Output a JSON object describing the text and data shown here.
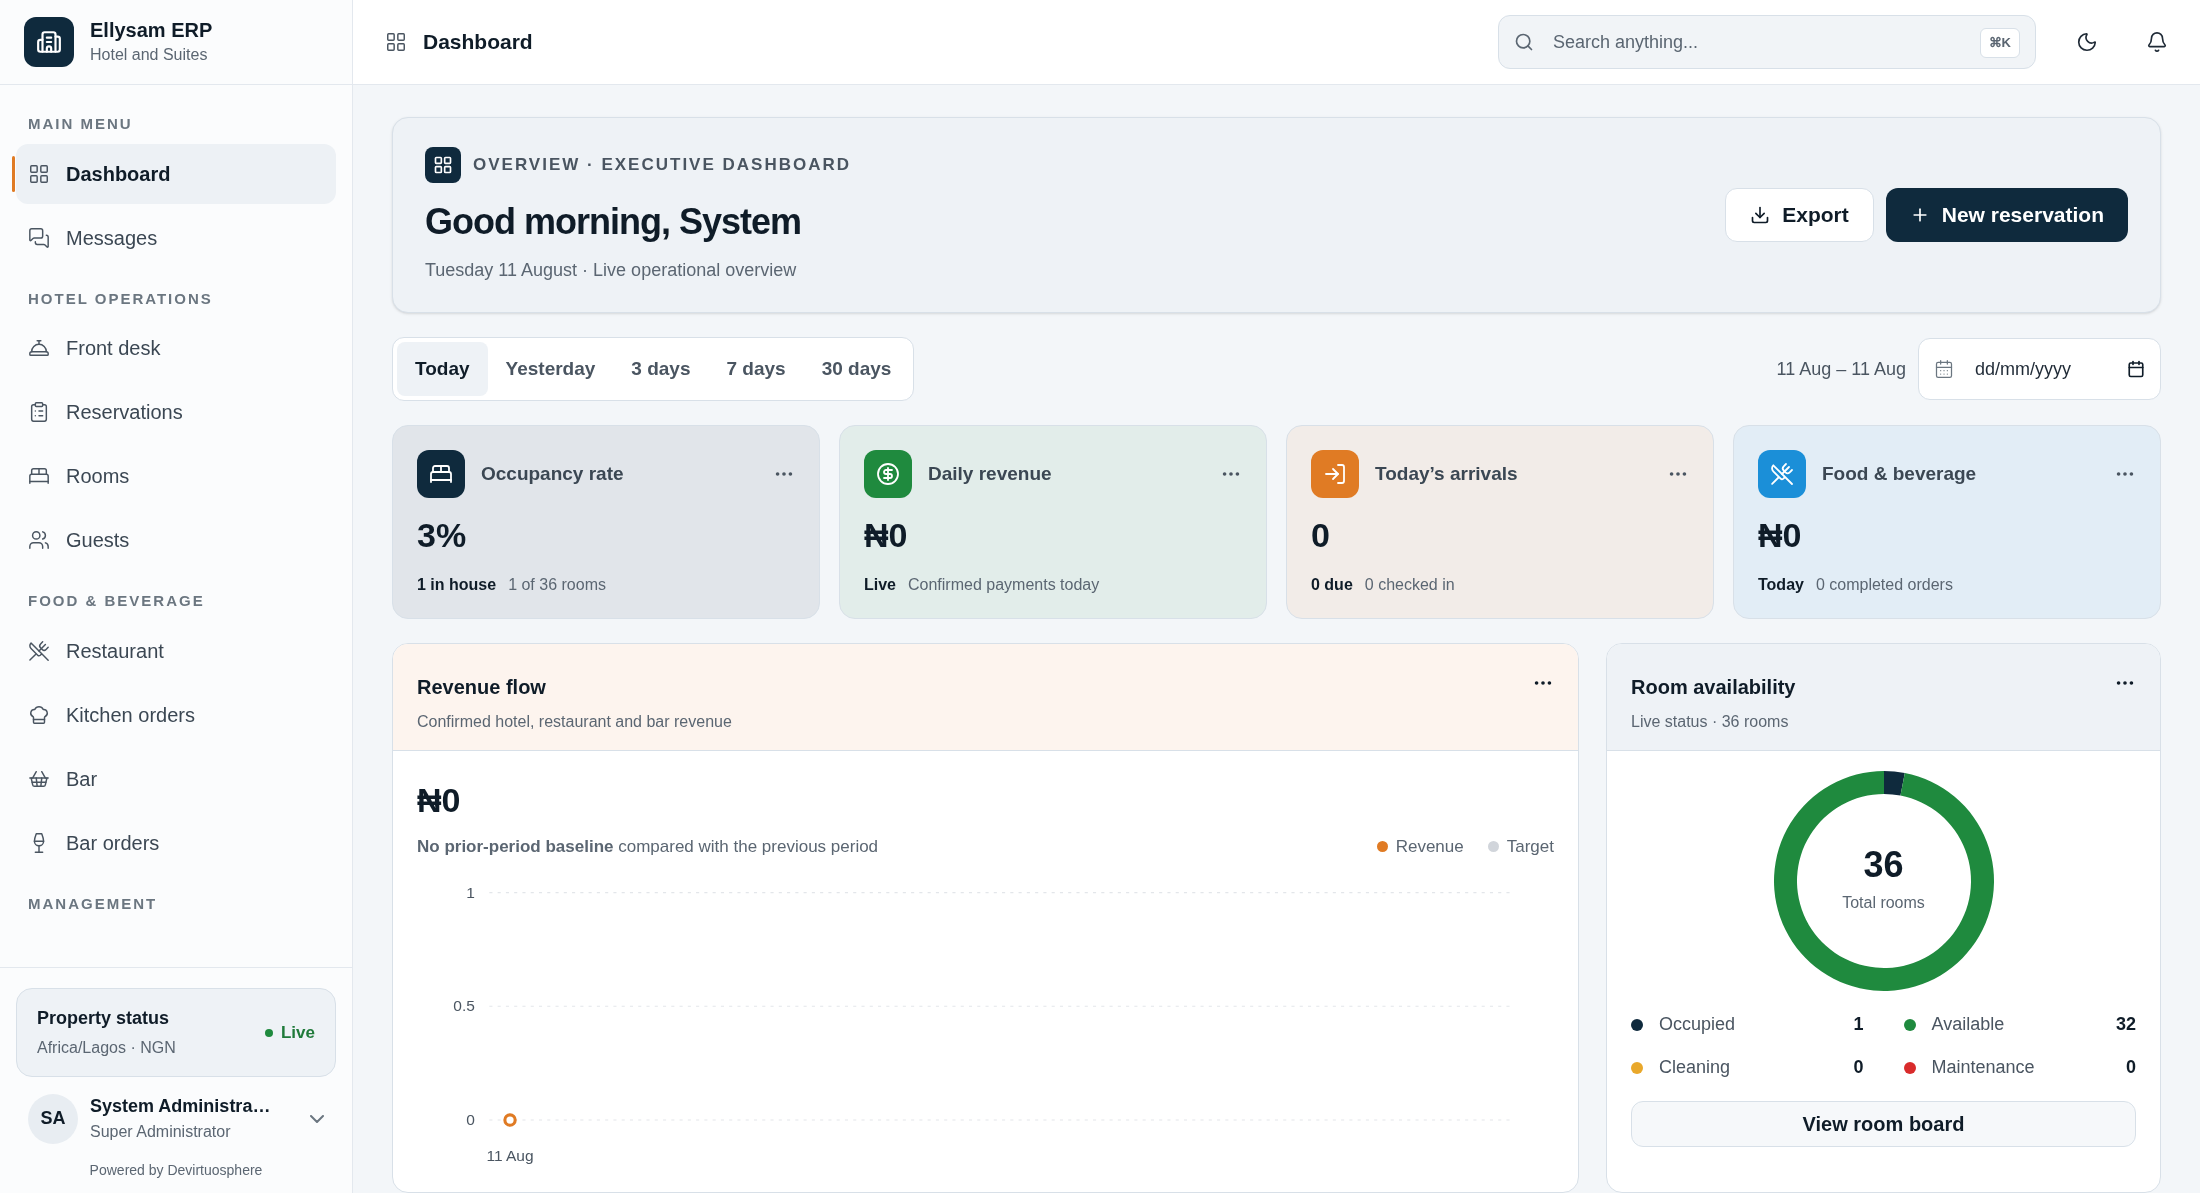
{
  "brand": {
    "name": "Ellysam ERP",
    "subtitle": "Hotel and Suites"
  },
  "sidebar": {
    "sections": [
      {
        "title": "MAIN MENU",
        "items": [
          {
            "label": "Dashboard",
            "selected": true
          },
          {
            "label": "Messages",
            "selected": false
          }
        ]
      },
      {
        "title": "HOTEL OPERATIONS",
        "items": [
          {
            "label": "Front desk",
            "selected": false
          },
          {
            "label": "Reservations",
            "selected": false
          },
          {
            "label": "Rooms",
            "selected": false
          },
          {
            "label": "Guests",
            "selected": false
          }
        ]
      },
      {
        "title": "FOOD & BEVERAGE",
        "items": [
          {
            "label": "Restaurant",
            "selected": false
          },
          {
            "label": "Kitchen orders",
            "selected": false
          },
          {
            "label": "Bar",
            "selected": false
          },
          {
            "label": "Bar orders",
            "selected": false
          }
        ]
      },
      {
        "title": "MANAGEMENT"
      }
    ]
  },
  "property_status": {
    "title": "Property status",
    "subtitle": "Africa/Lagos · NGN",
    "badge": "Live"
  },
  "user": {
    "initials": "SA",
    "name": "System Administra…",
    "role": "Super Administrator"
  },
  "footer": "Powered by Devirtuosphere",
  "header": {
    "title": "Dashboard",
    "search": {
      "placeholder": "Search anything...",
      "shortcut": "⌘K"
    }
  },
  "overview": {
    "eyebrow": "OVERVIEW · EXECUTIVE DASHBOARD",
    "heading": "Good morning, System",
    "subtitle": "Tuesday 11 August · Live operational overview",
    "buttons": [
      {
        "label": "Export",
        "kind": "secondary"
      },
      {
        "label": "New reservation",
        "kind": "primary"
      }
    ]
  },
  "ranges": [
    {
      "label": "Today",
      "selected": true
    },
    {
      "label": "Yesterday",
      "selected": false
    },
    {
      "label": "3 days",
      "selected": false
    },
    {
      "label": "7 days",
      "selected": false
    },
    {
      "label": "30 days",
      "selected": false
    }
  ],
  "date_range": "11 Aug – 11 Aug",
  "date_field": {
    "placeholder": "dd/mm/yyyy"
  },
  "stats": [
    {
      "title": "Occupancy rate",
      "value": "3%",
      "strong": "1 in house",
      "note": "1 of 36 rooms",
      "color": "#0f2a3d"
    },
    {
      "title": "Daily revenue",
      "value": "₦0",
      "strong": "Live",
      "note": "Confirmed payments today",
      "color": "#1f8a3e"
    },
    {
      "title": "Today’s arrivals",
      "value": "0",
      "strong": "0 due",
      "note": "0 checked in",
      "color": "#e07b24"
    },
    {
      "title": "Food & beverage",
      "value": "₦0",
      "strong": "Today",
      "note": "0 completed orders",
      "color": "#1b8fd8"
    }
  ],
  "revenue_flow": {
    "title": "Revenue flow",
    "subtitle": "Confirmed hotel, restaurant and bar revenue",
    "total": "₦0",
    "comparison": "**No prior-period baseline** compared with the previous period",
    "chart_data": {
      "type": "line",
      "x": [
        "11 Aug"
      ],
      "series": [
        {
          "name": "Revenue",
          "color": "#e07b24",
          "marker": "o",
          "values": [
            0
          ]
        },
        {
          "name": "Target",
          "color": "#d1d5db",
          "values": [
            null
          ]
        }
      ],
      "ylim": [
        0,
        1
      ],
      "yticks": [
        0,
        0.5,
        1
      ]
    }
  },
  "room_availability": {
    "title": "Room availability",
    "subtitle": "Live status · 36 rooms",
    "center_value": "36",
    "center_label": "Total rooms",
    "chart_data": {
      "type": "donut",
      "categories": [
        "Occupied",
        "Available",
        "Cleaning",
        "Maintenance"
      ],
      "values": [
        3.03,
        96.97,
        0,
        0
      ]
    },
    "legend": [
      {
        "count": "1",
        "color": "#0f2a3d"
      },
      {
        "count": "32",
        "color": "#1f8a3e"
      },
      {
        "count": "0",
        "color": "#e9a82b"
      },
      {
        "count": "0",
        "color": "#d92b2b"
      }
    ],
    "button": "View room board"
  }
}
